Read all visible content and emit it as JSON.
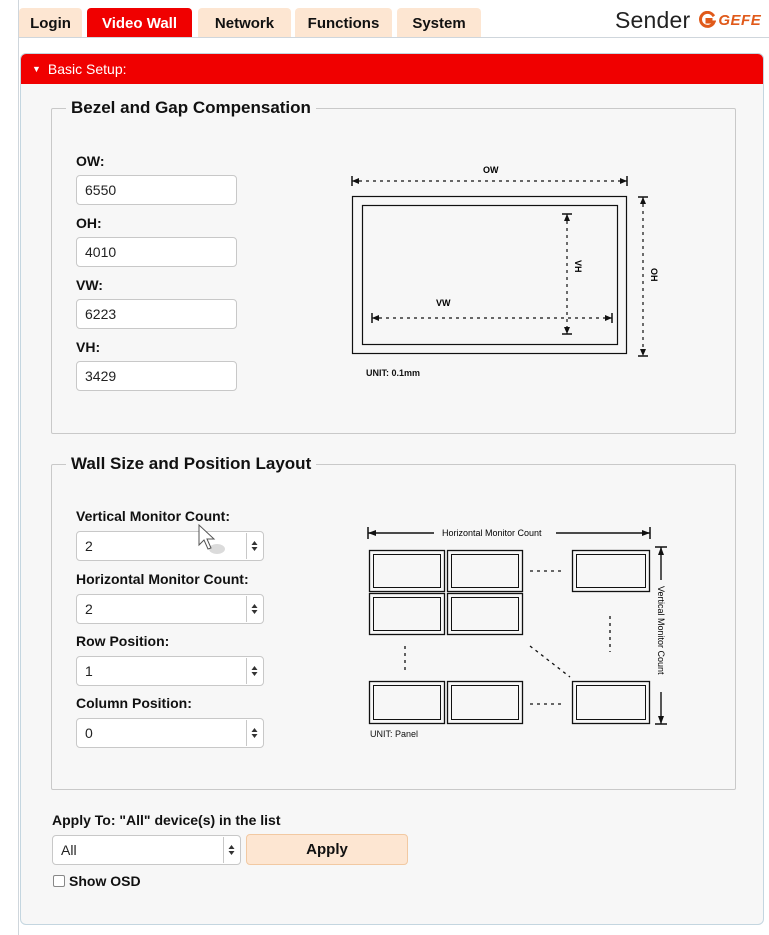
{
  "tabs": [
    {
      "label": "Login",
      "active": false
    },
    {
      "label": "Video Wall",
      "active": true
    },
    {
      "label": "Network",
      "active": false
    },
    {
      "label": "Functions",
      "active": false
    },
    {
      "label": "System",
      "active": false
    }
  ],
  "brand": {
    "title": "Sender",
    "logo_text": "GEFE"
  },
  "colors": {
    "accent": "#f00000",
    "tab_bg": "#fde6d2",
    "logo": "#e05a1a"
  },
  "panel": {
    "title": "Basic Setup:",
    "collapse_icon": "triangle-down-icon"
  },
  "bezel": {
    "legend": "Bezel and Gap Compensation",
    "fields": [
      {
        "label": "OW:",
        "value": "6550"
      },
      {
        "label": "OH:",
        "value": "4010"
      },
      {
        "label": "VW:",
        "value": "6223"
      },
      {
        "label": "VH:",
        "value": "3429"
      }
    ],
    "diagram": {
      "ow": "OW",
      "oh": "OH",
      "vw": "VW",
      "vh": "VH",
      "unit": "UNIT: 0.1mm"
    }
  },
  "wall": {
    "legend": "Wall Size and Position Layout",
    "fields": [
      {
        "label": "Vertical Monitor Count:",
        "value": "2"
      },
      {
        "label": "Horizontal Monitor Count:",
        "value": "2"
      },
      {
        "label": "Row Position:",
        "value": "1"
      },
      {
        "label": "Column Position:",
        "value": "0"
      }
    ],
    "diagram": {
      "horizontal_label": "Horizontal Monitor Count",
      "vertical_label": "Vertical Monitor Count",
      "unit": "UNIT: Panel"
    }
  },
  "apply": {
    "label": "Apply To: \"All\" device(s) in the list",
    "target": "All",
    "button": "Apply",
    "osd_label": "Show OSD",
    "osd_checked": false
  }
}
